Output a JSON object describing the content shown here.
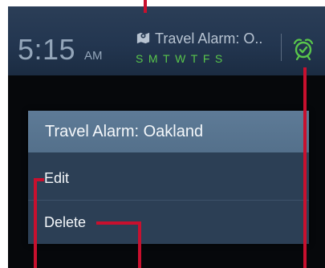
{
  "status": {
    "time": "5:15",
    "ampm": "AM"
  },
  "alarm": {
    "name": "Travel Alarm: O..",
    "days": [
      "S",
      "M",
      "T",
      "W",
      "T",
      "F",
      "S"
    ],
    "location_icon": "map-pin-icon",
    "clock_icon": "alarm-clock-icon"
  },
  "context_menu": {
    "title": "Travel Alarm: Oakland",
    "items": [
      {
        "label": "Edit"
      },
      {
        "label": "Delete"
      }
    ]
  },
  "colors": {
    "callout": "#c8102e",
    "day_active": "#59c64b",
    "menu_title_bg": "#5e7b97",
    "menu_bg": "#2c3f55"
  }
}
